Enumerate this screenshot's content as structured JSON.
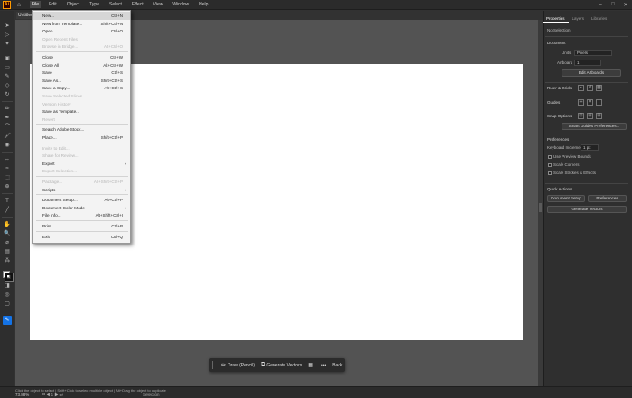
{
  "app": {
    "logo": "Ai",
    "home_icon": "home-icon"
  },
  "menubar": {
    "items": [
      "File",
      "Edit",
      "Object",
      "Type",
      "Select",
      "Effect",
      "View",
      "Window",
      "Help"
    ],
    "active": "File",
    "window_controls": [
      "–",
      "□",
      "✕"
    ]
  },
  "document": {
    "tab_title": "Untitled"
  },
  "file_menu": {
    "items": [
      {
        "label": "New...",
        "shortcut": "Ctrl+N",
        "disabled": false
      },
      {
        "label": "New from Template...",
        "shortcut": "Shift+Ctrl+N",
        "disabled": false
      },
      {
        "label": "Open...",
        "shortcut": "Ctrl+O",
        "disabled": false
      },
      {
        "label": "Open Recent Files",
        "shortcut": "",
        "disabled": true
      },
      {
        "label": "Browse in Bridge...",
        "shortcut": "Alt+Ctrl+O",
        "disabled": true
      },
      {
        "label": "Close",
        "shortcut": "Ctrl+W",
        "disabled": false
      },
      {
        "label": "Close All",
        "shortcut": "Alt+Ctrl+W",
        "disabled": false
      },
      {
        "label": "Save",
        "shortcut": "Ctrl+S",
        "disabled": false
      },
      {
        "label": "Save As...",
        "shortcut": "Shift+Ctrl+S",
        "disabled": false
      },
      {
        "label": "Save a Copy...",
        "shortcut": "Alt+Ctrl+S",
        "disabled": false
      },
      {
        "label": "Save Selected Slices...",
        "shortcut": "",
        "disabled": true
      },
      {
        "label": "Version History",
        "shortcut": "",
        "disabled": true
      },
      {
        "label": "Save as Template...",
        "shortcut": "",
        "disabled": false
      },
      {
        "label": "Revert",
        "shortcut": "",
        "disabled": true
      },
      {
        "label": "Search Adobe Stock...",
        "shortcut": "",
        "disabled": false
      },
      {
        "label": "Place...",
        "shortcut": "Shift+Ctrl+P",
        "disabled": false
      },
      {
        "label": "Invite to Edit...",
        "shortcut": "",
        "disabled": true
      },
      {
        "label": "Share for Review...",
        "shortcut": "",
        "disabled": true
      },
      {
        "label": "Export",
        "shortcut": "",
        "disabled": false,
        "submenu": true
      },
      {
        "label": "Export Selection...",
        "shortcut": "",
        "disabled": true
      },
      {
        "label": "Package...",
        "shortcut": "Alt+Shift+Ctrl+P",
        "disabled": true
      },
      {
        "label": "Scripts",
        "shortcut": "",
        "disabled": false,
        "submenu": true
      },
      {
        "label": "Document Setup...",
        "shortcut": "Alt+Ctrl+P",
        "disabled": false
      },
      {
        "label": "Document Color Mode",
        "shortcut": "",
        "disabled": false,
        "submenu": true
      },
      {
        "label": "File Info...",
        "shortcut": "Alt+Shift+Ctrl+I",
        "disabled": false
      },
      {
        "label": "Print...",
        "shortcut": "Ctrl+P",
        "disabled": false
      },
      {
        "label": "Exit",
        "shortcut": "Ctrl+Q",
        "disabled": false
      }
    ],
    "submenu_arrow": "›"
  },
  "context_bar": {
    "draw_label": "Draw (Pencil)",
    "generate_label": "Generate Vectors",
    "more_label": "•••",
    "back_label": "Back"
  },
  "statusbar": {
    "hint": "Click the object to select  |  Shift+Click to select multiple object  |  Alt+Drag the object to duplicate",
    "zoom": "73.88%",
    "artboard_nav": "⏮ ◀  1  ▶ ⏭",
    "selection": "Selection"
  },
  "right_panel": {
    "tabs": [
      "Properties",
      "Layers",
      "Libraries"
    ],
    "no_selection": "No Selection",
    "document_heading": "Document",
    "units_label": "Units",
    "units_value": "Pixels",
    "artboard_label": "Artboard",
    "artboard_value": "1",
    "edit_artboards_btn": "Edit Artboards",
    "ruler_grids_heading": "Ruler & Grids",
    "guides_heading": "Guides",
    "snap_options_heading": "Snap Options",
    "smart_guides_btn": "Smart Guides Preferences...",
    "preferences_heading": "Preferences",
    "keyboard_increment_label": "Keyboard Increment",
    "keyboard_increment_value": "1 px",
    "use_preview_bounds": "Use Preview Bounds",
    "scale_corners": "Scale Corners",
    "scale_strokes": "Scale Strokes & Effects",
    "quick_actions_heading": "Quick Actions",
    "document_setup_btn": "Document Setup",
    "preferences_btn": "Preferences",
    "generate_vectors_btn": "Generate Vectors"
  }
}
